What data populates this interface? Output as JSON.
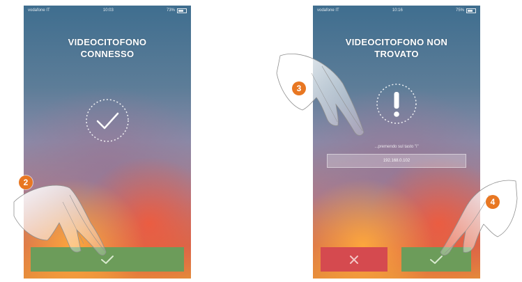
{
  "left_screen": {
    "status_bar": {
      "left": "vodafone IT",
      "time": "10:03",
      "right": "73%"
    },
    "title": "VIDEOCITOFONO\nCONNESSO",
    "icon": "checkmark-icon",
    "confirm_icon": "checkmark-icon",
    "callout": "2"
  },
  "right_screen": {
    "status_bar": {
      "left": "vodafone IT",
      "time": "10:16",
      "right": "75%"
    },
    "title": "VIDEOCITOFONO NON\nTROVATO",
    "icon": "exclamation-icon",
    "instruction": "...premendo sul tasto \"i\"",
    "ip_value": "192.168.0.102",
    "cancel_icon": "close-icon",
    "confirm_icon": "checkmark-icon",
    "callout_pointer": "3",
    "callout_confirm": "4"
  },
  "colors": {
    "callout": "#e87722",
    "confirm": "#6c9c5a",
    "cancel": "#d54a4f"
  }
}
